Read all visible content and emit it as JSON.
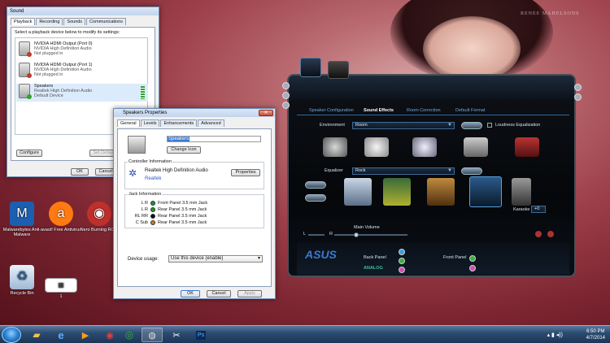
{
  "desktop": {
    "wall_text_top": "RENEE MAHELSONS",
    "icons": [
      {
        "label": "Malwarebytes Anti-Malware"
      },
      {
        "label": "avast! Free Antivirus"
      },
      {
        "label": "Nero Burning ROM"
      },
      {
        "label": "Recycle Bin"
      },
      {
        "label": "1"
      }
    ]
  },
  "sound_dialog": {
    "title": "Sound",
    "tabs": [
      "Playback",
      "Recording",
      "Sounds",
      "Communications"
    ],
    "instruction": "Select a playback device below to modify its settings:",
    "devices": [
      {
        "name": "NVIDIA HDMI Output (Port 0)",
        "driver": "NVIDIA High Definition Audio",
        "status": "Not plugged in"
      },
      {
        "name": "NVIDIA HDMI Output (Port 1)",
        "driver": "NVIDIA High Definition Audio",
        "status": "Not plugged in"
      },
      {
        "name": "Speakers",
        "driver": "Realtek High Definition Audio",
        "status": "Default Device"
      }
    ],
    "configure": "Configure",
    "set_default": "Set Default",
    "ok": "OK",
    "cancel": "Cancel"
  },
  "asus": {
    "tabs": [
      "Speaker Configuration",
      "Sound Effects",
      "Room Correction",
      "Default Format"
    ],
    "environment_label": "Environment",
    "environment_value": "Room",
    "loudness": "Loudness Equalization",
    "equalizer_label": "Equalizer",
    "equalizer_value": "Rock",
    "karaoke_label": "Karaoke",
    "karaoke_value": "+0",
    "main_volume": "Main Volume",
    "l_label": "L",
    "r_label": "R",
    "logo": "ASUS",
    "back_panel": "Back Panel",
    "front_panel": "Front Panel",
    "analog": "ANALOG"
  },
  "props": {
    "title": "Speakers Properties",
    "tabs": [
      "General",
      "Levels",
      "Enhancements",
      "Advanced"
    ],
    "name_value": "Speakers",
    "change_icon": "Change Icon",
    "controller_title": "Controller Information",
    "controller_name": "Realtek High Definition Audio",
    "controller_vendor": "Realtek",
    "properties_btn": "Properties",
    "jack_title": "Jack Information",
    "jacks": [
      {
        "channel": "L R",
        "desc": "Front Panel 3.5 mm Jack",
        "color": "#1a9a2a"
      },
      {
        "channel": "L R",
        "desc": "Rear Panel 3.5 mm Jack",
        "color": "#1a9a2a"
      },
      {
        "channel": "RL RR",
        "desc": "Rear Panel 3.5 mm Jack",
        "color": "#111111"
      },
      {
        "channel": "C Sub",
        "desc": "Rear Panel 3.5 mm Jack",
        "color": "#d07a10"
      }
    ],
    "device_usage_label": "Device usage:",
    "device_usage_value": "Use this device (enable)",
    "ok": "OK",
    "cancel": "Cancel",
    "apply": "Apply"
  },
  "taskbar": {
    "time": "6:50 PM",
    "date": "4/7/2014"
  }
}
